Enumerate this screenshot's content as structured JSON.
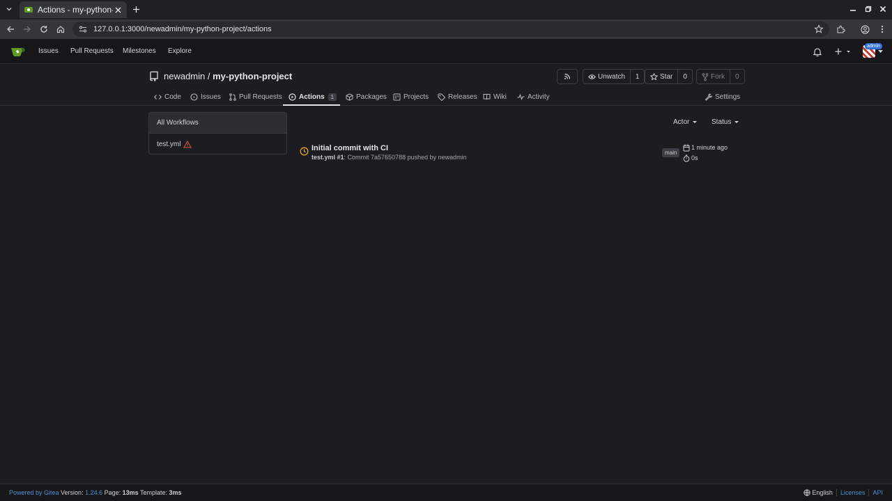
{
  "browser": {
    "tab_title": "Actions - my-python-p",
    "url": "127.0.0.1:3000/newadmin/my-python-project/actions"
  },
  "topnav": {
    "links": [
      "Issues",
      "Pull Requests",
      "Milestones",
      "Explore"
    ],
    "avatar_badge": "admin"
  },
  "repo": {
    "owner": "newadmin",
    "separator": " / ",
    "name": "my-python-project",
    "watch": {
      "label": "Unwatch",
      "count": "1"
    },
    "star": {
      "label": "Star",
      "count": "0"
    },
    "fork": {
      "label": "Fork",
      "count": "0"
    }
  },
  "tabs": {
    "code": "Code",
    "issues": "Issues",
    "pull_requests": "Pull Requests",
    "actions": "Actions",
    "actions_count": "1",
    "packages": "Packages",
    "projects": "Projects",
    "releases": "Releases",
    "wiki": "Wiki",
    "activity": "Activity",
    "settings": "Settings"
  },
  "workflows": {
    "all": "All Workflows",
    "items": [
      {
        "name": "test.yml",
        "icon": "warning-icon"
      }
    ]
  },
  "filters": {
    "actor": "Actor",
    "status": "Status"
  },
  "runs": [
    {
      "title": "Initial commit with CI",
      "workflow": "test.yml",
      "run_number": " #1",
      "detail": ": Commit 7a57650788 pushed by newadmin",
      "branch": "main",
      "time": "1 minute ago",
      "duration": "0s",
      "status_color": "#e3a22b"
    }
  ],
  "footer": {
    "powered_by": "Powered by Gitea",
    "version_label": " Version: ",
    "version": "1.24.6",
    "page_label": " Page: ",
    "page_time": "13ms",
    "template_label": " Template: ",
    "template_time": "3ms",
    "language": "English",
    "licenses": "Licenses",
    "api": "API"
  }
}
